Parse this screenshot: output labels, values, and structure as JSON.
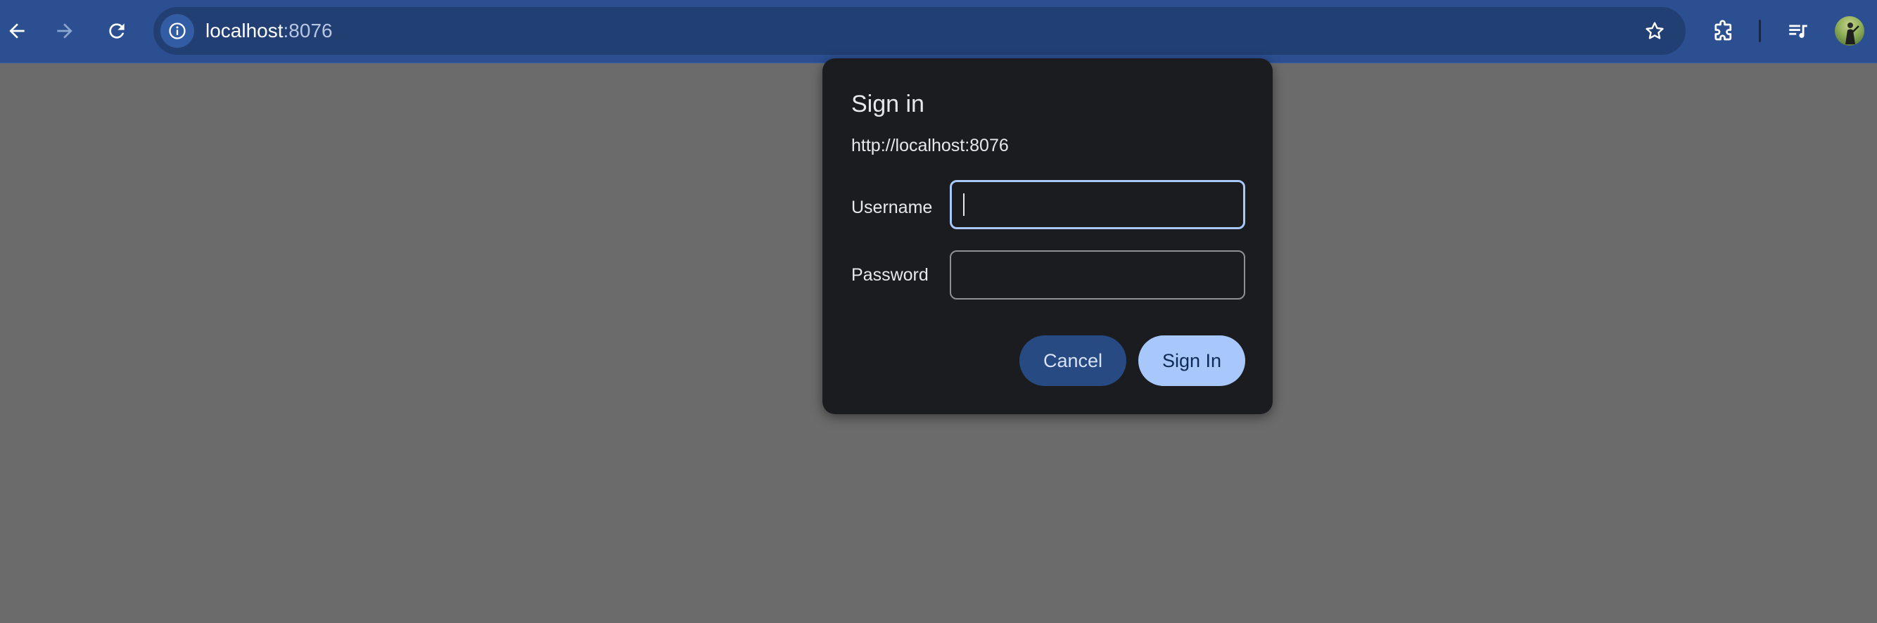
{
  "browser": {
    "url_host": "localhost",
    "url_port": ":8076",
    "icons": {
      "back": "arrow-left-icon",
      "forward": "arrow-right-icon",
      "reload": "reload-icon",
      "site_info": "info-icon",
      "bookmark": "star-icon",
      "extensions": "puzzle-icon",
      "media": "media-queue-icon",
      "profile": "avatar"
    }
  },
  "dialog": {
    "title": "Sign in",
    "origin": "http://localhost:8076",
    "username_label": "Username",
    "username_value": "",
    "password_label": "Password",
    "password_value": "",
    "cancel_label": "Cancel",
    "submit_label": "Sign In"
  },
  "colors": {
    "toolbar": "#2b4f91",
    "omnibox": "#213f73",
    "page_background": "#6b6b6b",
    "dialog_background": "#1b1c1f",
    "focus_ring": "#a8c7fa",
    "cancel_button": "#274a82",
    "primary_button": "#a8c7fa"
  }
}
